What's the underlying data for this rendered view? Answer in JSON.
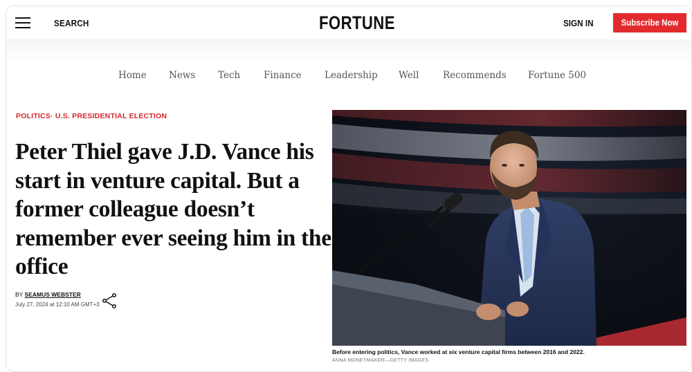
{
  "header": {
    "search_label": "SEARCH",
    "logo": "FORTUNE",
    "signin_label": "SIGN IN",
    "subscribe_label": "Subscribe Now",
    "subscribe_color": "#e32b2f"
  },
  "nav": {
    "items": [
      "Home",
      "News",
      "Tech",
      "Finance",
      "Leadership",
      "Well",
      "Recommends",
      "Fortune 500"
    ]
  },
  "article": {
    "category": "POLITICS· U.S. PRESIDENTIAL ELECTION",
    "headline": "Peter Thiel gave J.D. Vance his start in venture capital. But a former colleague doesn’t remember ever seeing him in the office",
    "byline_prefix": "BY ",
    "author": "SEAMUS WEBSTER",
    "date": "July 27, 2024 at 12:10 AM GMT+3",
    "share_icon": "share-icon",
    "image_caption": "Before entering politics, Vance worked at six venture capital firms between 2016 and 2022.",
    "image_credit": "ANNA MONEYMAKER—GETTY IMAGES",
    "accent_color": "#d4262a"
  }
}
